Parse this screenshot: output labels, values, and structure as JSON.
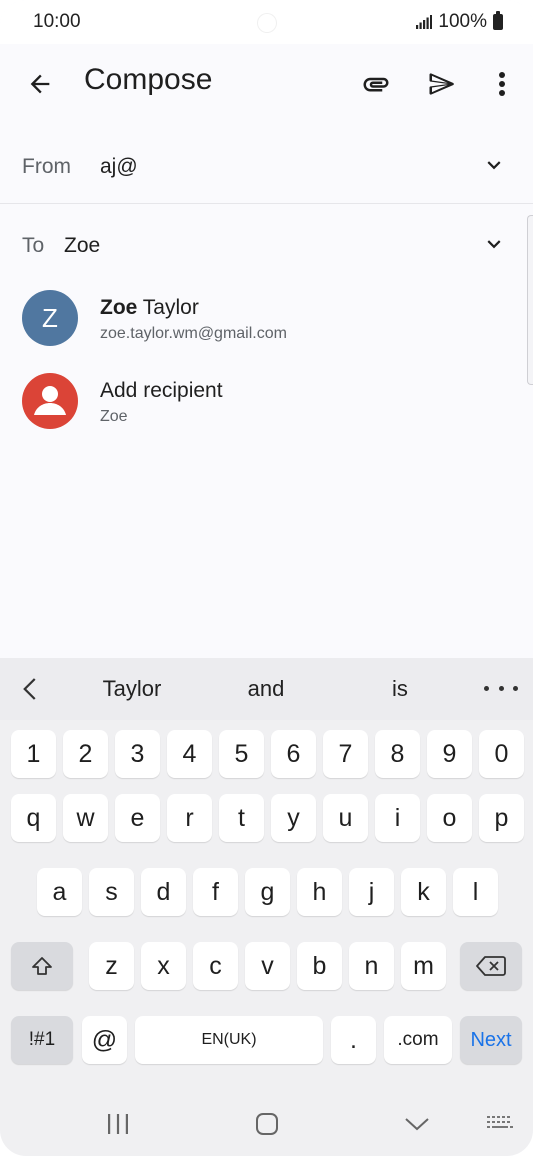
{
  "status_bar": {
    "time": "10:00",
    "battery": "100%"
  },
  "app_bar": {
    "title": "Compose"
  },
  "from": {
    "label": "From",
    "value": "aj@"
  },
  "to": {
    "label": "To",
    "value": "Zoe"
  },
  "suggestions": [
    {
      "avatar_letter": "Z",
      "name_match": "Zoe",
      "name_rest": " Taylor",
      "sub": "zoe.taylor.wm@gmail.com"
    },
    {
      "name": "Add recipient",
      "sub": "Zoe"
    }
  ],
  "keyboard": {
    "predictions": [
      "Taylor",
      "and",
      "is"
    ],
    "number_row": [
      "1",
      "2",
      "3",
      "4",
      "5",
      "6",
      "7",
      "8",
      "9",
      "0"
    ],
    "row1": [
      "q",
      "w",
      "e",
      "r",
      "t",
      "y",
      "u",
      "i",
      "o",
      "p"
    ],
    "row2": [
      "a",
      "s",
      "d",
      "f",
      "g",
      "h",
      "j",
      "k",
      "l"
    ],
    "row3": [
      "z",
      "x",
      "c",
      "v",
      "b",
      "n",
      "m"
    ],
    "symbols_label": "!#1",
    "at_label": "@",
    "space_label": "EN(UK)",
    "period_label": ".",
    "dotcom_label": ".com",
    "next_label": "Next"
  },
  "colors": {
    "avatar_blue": "#5077a0",
    "avatar_red": "#db4437",
    "accent": "#1a73e8"
  }
}
